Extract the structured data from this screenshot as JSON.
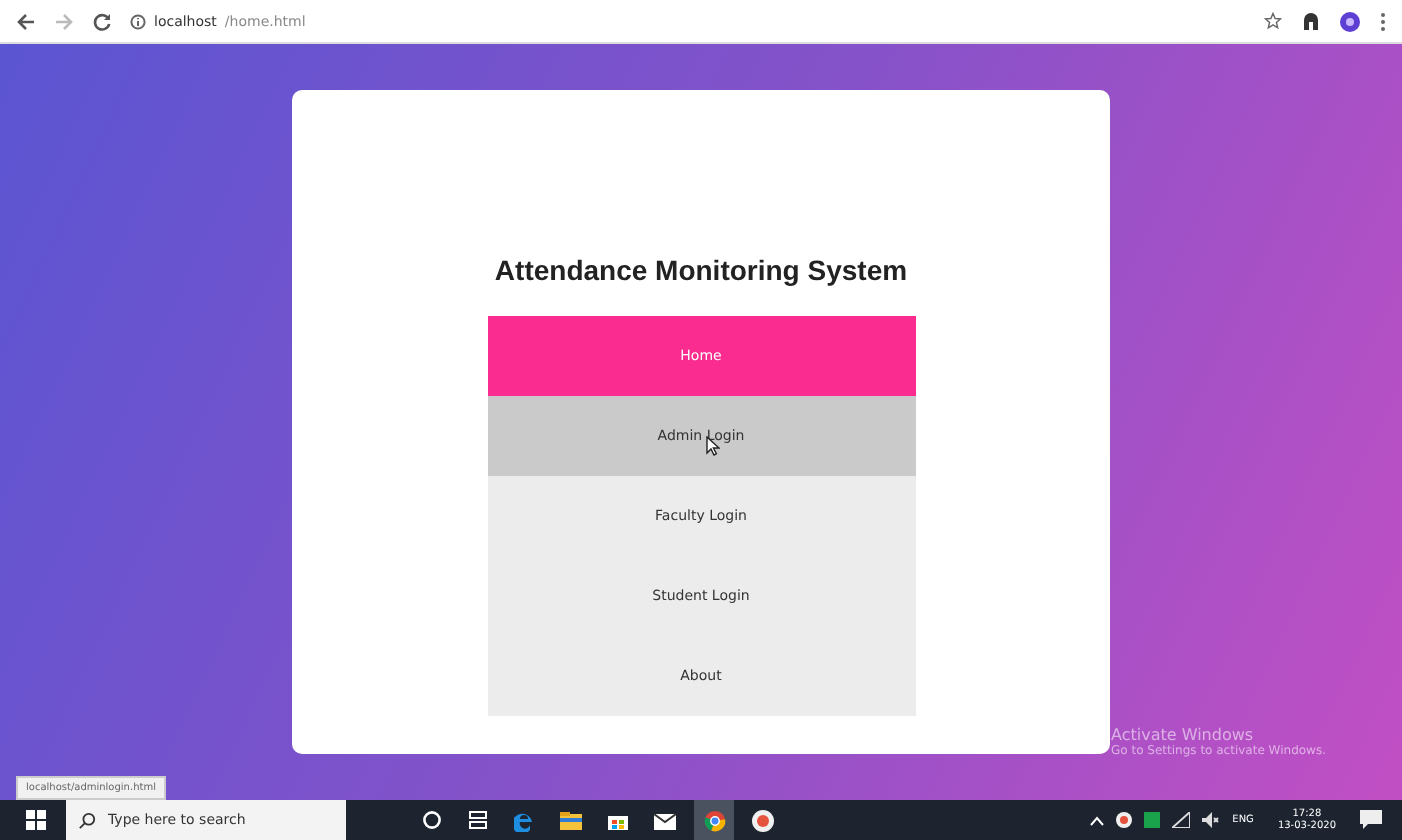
{
  "browser": {
    "url_host": "localhost",
    "url_path": "/home.html",
    "status_url": "localhost/adminlogin.html"
  },
  "page": {
    "title": "Attendance Monitoring System",
    "menu": [
      {
        "label": "Home",
        "selected": true,
        "hovered": false
      },
      {
        "label": "Admin Login",
        "selected": false,
        "hovered": true
      },
      {
        "label": "Faculty Login",
        "selected": false,
        "hovered": false
      },
      {
        "label": "Student Login",
        "selected": false,
        "hovered": false
      },
      {
        "label": "About",
        "selected": false,
        "hovered": false
      }
    ]
  },
  "activation_notice": {
    "title": "Activate Windows",
    "text": "Go to Settings to activate Windows."
  },
  "taskbar": {
    "search_placeholder": "Type here to search",
    "language": "ENG",
    "time": "17:28",
    "date": "13-03-2020"
  }
}
